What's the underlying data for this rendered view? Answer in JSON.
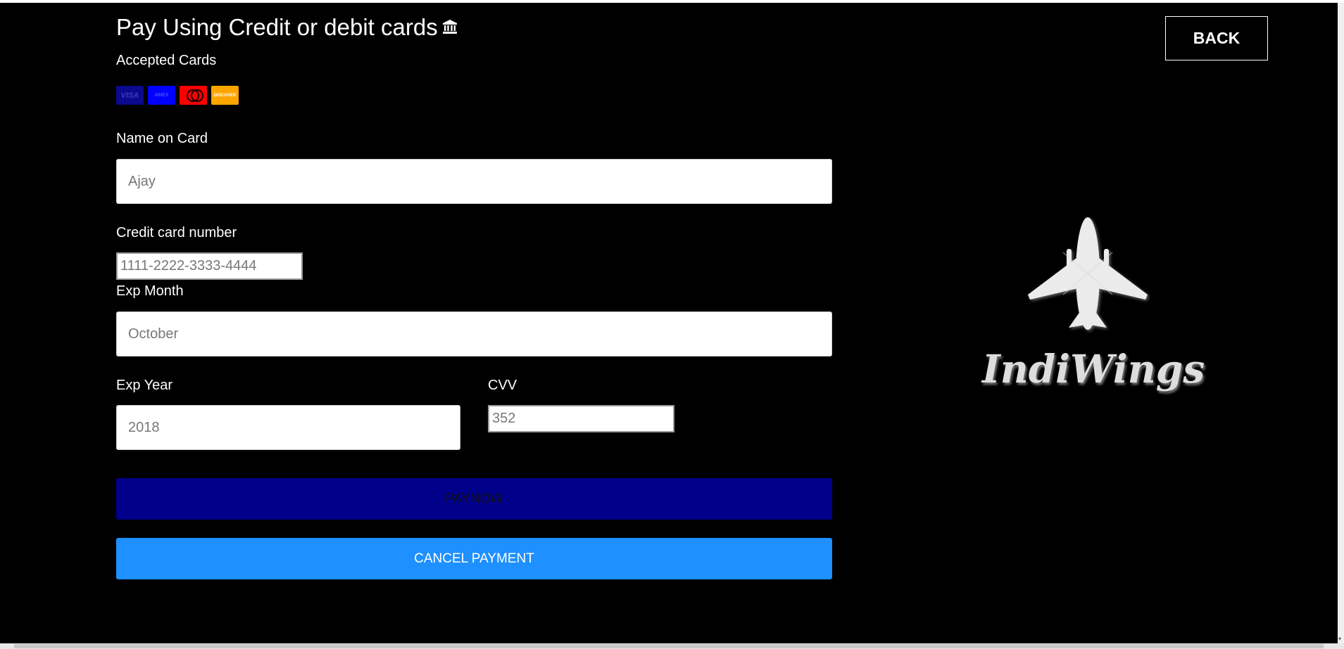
{
  "header": {
    "title": "Pay Using Credit or debit cards",
    "back_label": "BACK"
  },
  "accepted_cards": {
    "label": "Accepted Cards",
    "cards": [
      "VISA",
      "AMEX",
      "mastercard",
      "DISCOVER"
    ]
  },
  "form": {
    "name_label": "Name on Card",
    "name_placeholder": "Ajay",
    "card_number_label": "Credit card number",
    "card_number_placeholder": "1111-2222-3333-4444",
    "exp_month_label": "Exp Month",
    "exp_month_placeholder": "October",
    "exp_year_label": "Exp Year",
    "exp_year_placeholder": "2018",
    "cvv_label": "CVV",
    "cvv_placeholder": "352"
  },
  "buttons": {
    "pay_label": "PAYNOW",
    "cancel_label": "CANCEL PAYMENT"
  },
  "brand": {
    "name": "IndiWings"
  },
  "colors": {
    "pay_button": "#00008b",
    "cancel_button": "#1e90ff",
    "background": "#000000"
  }
}
